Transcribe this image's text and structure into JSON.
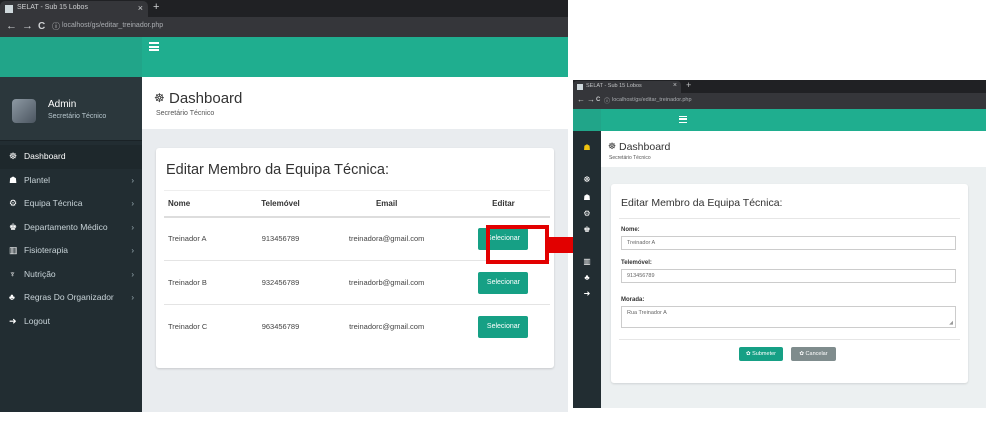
{
  "left": {
    "tab_title": "SELAT - Sub 15 Lobos",
    "tab_close": "×",
    "tab_new": "+",
    "nav": {
      "back": "←",
      "forward": "→",
      "reload": "C",
      "info": "ⓘ"
    },
    "url": "localhost/gs/editar_treinador.php",
    "hamburger": "menu",
    "user": {
      "name": "Admin",
      "role": "Secretário Técnico"
    },
    "menu": [
      {
        "icon": "☸",
        "label": "Dashboard",
        "chevron": ""
      },
      {
        "icon": "☗",
        "label": "Plantel",
        "chevron": "›"
      },
      {
        "icon": "⚙",
        "label": "Equipa Técnica",
        "chevron": "›"
      },
      {
        "icon": "♚",
        "label": "Departamento Médico",
        "chevron": "›"
      },
      {
        "icon": "▥",
        "label": "Fisioterapia",
        "chevron": "›"
      },
      {
        "icon": "♆",
        "label": "Nutrição",
        "chevron": "›"
      },
      {
        "icon": "♣",
        "label": "Regras Do Organizador",
        "chevron": "›"
      },
      {
        "icon": "➜",
        "label": "Logout",
        "chevron": ""
      }
    ],
    "header": {
      "icon": "☸",
      "title": "Dashboard",
      "subtitle": "Secretário Técnico"
    },
    "box_title": "Editar Membro da Equipa Técnica:",
    "table": {
      "columns": [
        "Nome",
        "Telemóvel",
        "Email",
        "Editar"
      ],
      "rows": [
        {
          "nome": "Treinador A",
          "telemovel": "913456789",
          "email": "treinadora@gmail.com",
          "editar": "Selecionar"
        },
        {
          "nome": "Treinador B",
          "telemovel": "932456789",
          "email": "treinadorb@gmail.com",
          "editar": "Selecionar"
        },
        {
          "nome": "Treinador C",
          "telemovel": "963456789",
          "email": "treinadorc@gmail.com",
          "editar": "Selecionar"
        }
      ]
    }
  },
  "highlight_color": "#e20000",
  "accent_color": "#1fae8f",
  "right": {
    "tab_title": "SELAT - Sub 15 Lobos",
    "tab_close": "×",
    "tab_new": "+",
    "nav": {
      "back": "←",
      "forward": "→",
      "reload": "C",
      "info": "ⓘ"
    },
    "url": "localhost/gs/editar_treinador.php",
    "sidebar_icons": [
      "☗",
      "☸",
      "☗",
      "⚙",
      "♚",
      "▥",
      "♣",
      "➜"
    ],
    "header": {
      "icon": "☸",
      "title": "Dashboard",
      "subtitle": "Secretário Técnico"
    },
    "form": {
      "title": "Editar Membro da Equipa Técnica:",
      "nome_label": "Nome:",
      "nome_value": "Treinador A",
      "telemovel_label": "Telemóvel:",
      "telemovel_value": "913456789",
      "morada_label": "Morada:",
      "morada_value": "Rua Treinador A",
      "submit_label": "✿ Submeter",
      "cancel_label": "✿ Cancelar"
    }
  }
}
